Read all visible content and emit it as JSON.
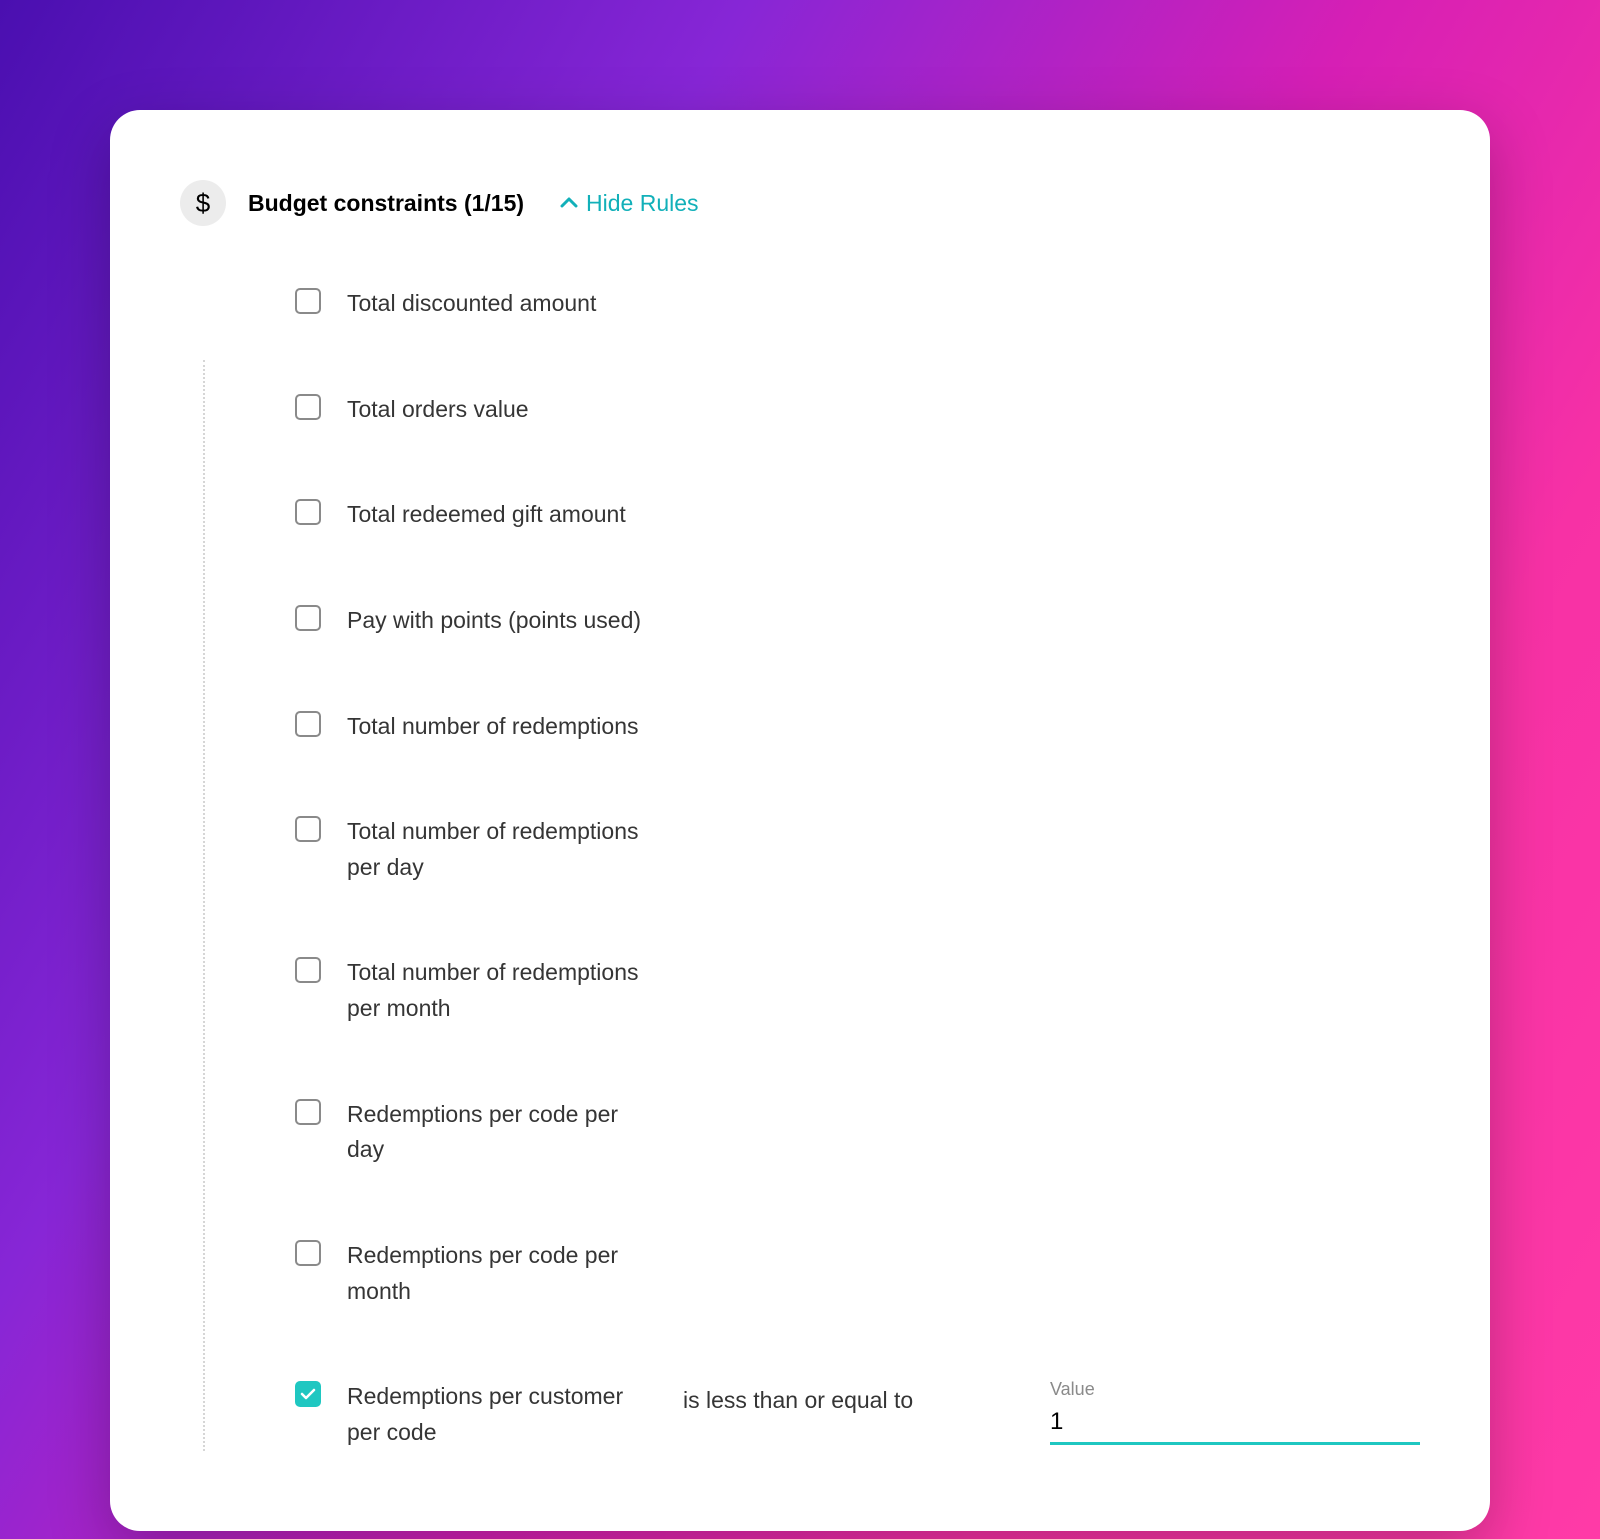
{
  "header": {
    "icon_glyph": "$",
    "title": "Budget constraints (1/15)",
    "toggle_label": "Hide Rules"
  },
  "rules": [
    {
      "label": "Total discounted amount",
      "checked": false
    },
    {
      "label": "Total orders value",
      "checked": false
    },
    {
      "label": "Total redeemed gift amount",
      "checked": false
    },
    {
      "label": "Pay with points (points used)",
      "checked": false
    },
    {
      "label": "Total number of redemptions",
      "checked": false
    },
    {
      "label": "Total number of redemptions per day",
      "checked": false
    },
    {
      "label": "Total number of redemptions per month",
      "checked": false
    },
    {
      "label": "Redemptions per code per day",
      "checked": false
    },
    {
      "label": "Redemptions per code per month",
      "checked": false
    },
    {
      "label": "Redemptions per customer per code",
      "checked": true,
      "condition": "is less than or equal to",
      "value_label": "Value",
      "value": "1"
    }
  ]
}
